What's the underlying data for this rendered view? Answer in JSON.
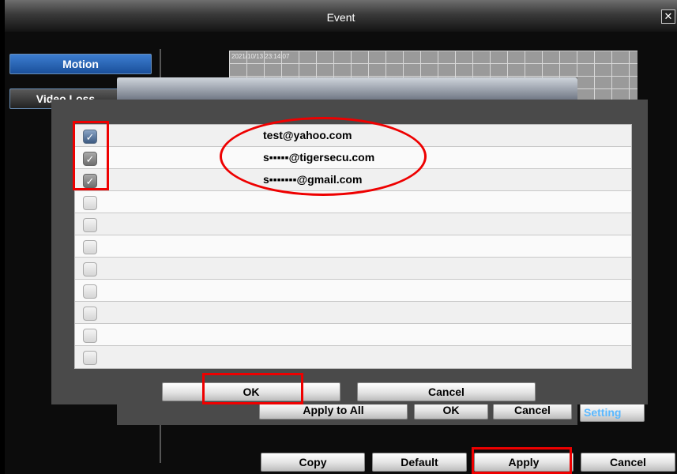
{
  "window": {
    "title": "Event",
    "close_glyph": "✕"
  },
  "sidebar": {
    "items": [
      {
        "label": "Motion"
      },
      {
        "label": "Video Loss"
      }
    ]
  },
  "preview": {
    "timestamp": "2021/10/13 23:14:07"
  },
  "inner_dialog": {
    "buttons": {
      "apply_to_all": "Apply to All",
      "ok": "OK",
      "cancel": "Cancel",
      "setting": "Setting"
    }
  },
  "email_popup": {
    "rows": [
      {
        "email": "test@yahoo.com",
        "checked": true
      },
      {
        "email": "s▪▪▪▪▪@tigersecu.com",
        "checked": true
      },
      {
        "email": "s▪▪▪▪▪▪▪@gmail.com",
        "checked": true
      },
      {
        "email": "",
        "checked": false
      },
      {
        "email": "",
        "checked": false
      },
      {
        "email": "",
        "checked": false
      },
      {
        "email": "",
        "checked": false
      },
      {
        "email": "",
        "checked": false
      },
      {
        "email": "",
        "checked": false
      },
      {
        "email": "",
        "checked": false
      },
      {
        "email": "",
        "checked": false
      }
    ],
    "buttons": {
      "ok": "OK",
      "cancel": "Cancel"
    },
    "check_glyph": "✓"
  },
  "footer": {
    "buttons": {
      "copy": "Copy",
      "default": "Default",
      "apply": "Apply",
      "cancel": "Cancel"
    }
  },
  "colors": {
    "accent_blue": "#2a66b8",
    "annotation_red": "#e00000"
  }
}
